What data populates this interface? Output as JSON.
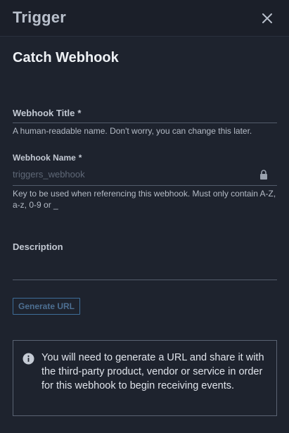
{
  "header": {
    "title": "Trigger",
    "close_icon": "close-icon"
  },
  "section": {
    "title": "Catch Webhook"
  },
  "form": {
    "webhook_title": {
      "label": "Webhook Title",
      "required_mark": "*",
      "value": "",
      "helper": "A human-readable name. Don't worry, you can change this later."
    },
    "webhook_name": {
      "label": "Webhook Name",
      "required_mark": "*",
      "value": "triggers_webhook",
      "locked_icon": "lock-icon",
      "helper": "Key to be used when referencing this webhook. Must only contain A-Z, a-z, 0-9 or _"
    },
    "description": {
      "label": "Description",
      "value": ""
    },
    "generate_button_label": "Generate URL"
  },
  "info": {
    "icon": "info-icon",
    "text": "You will need to generate a URL and share it with the third-party product, vendor or service in order for this webhook to begin receiving events."
  },
  "colors": {
    "background": "#1e232e",
    "header_background": "#1b1f29",
    "button_border": "#3e6e99",
    "info_border": "#5a6372"
  }
}
